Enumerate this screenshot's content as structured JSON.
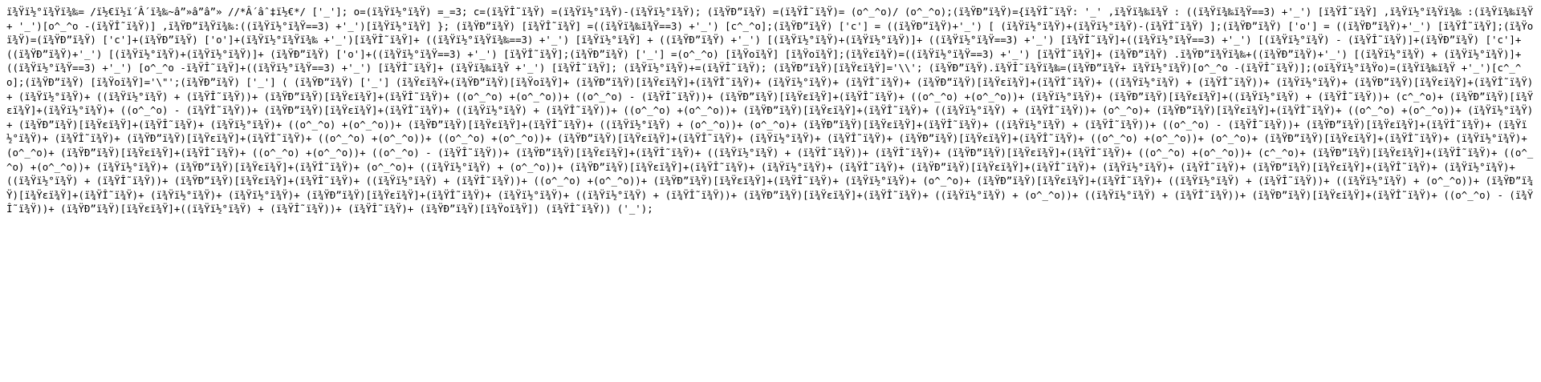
{
  "document": {
    "text_color": "#000000",
    "background_color": "#ffffff",
    "content": "ï¾Ÿï½°ï¾Ÿï¾‰= /ï½€ï½ï´Â´ï¾‰~â”»â”â”» //*Â´âˆ‡ï½€*/ ['_']; o=(ï¾Ÿï½°ï¾Ÿ) =_=3; c=(ï¾ŸÎ˜ï¾Ÿ) =(ï¾Ÿï½°ï¾Ÿ)-(ï¾Ÿï½°ï¾Ÿ); (ï¾ŸÐ”ï¾Ÿ) =(ï¾ŸÎ˜ï¾Ÿ)= (o^_^o)/ (o^_^o);(ï¾ŸÐ”ï¾Ÿ)={ï¾ŸÎ˜ï¾Ÿ: '_' ,ï¾Ÿï¾‰ï¾Ÿ : ((ï¾Ÿï¾‰ï¾Ÿ==3) +'_') [ï¾ŸÎ˜ï¾Ÿ] ,ï¾Ÿï½°ï¾Ÿï¾‰ :(ï¾Ÿï¾‰ï¾Ÿ+ '_')[o^_^o -(ï¾ŸÎ˜ï¾Ÿ)] ,ï¾ŸÐ”ï¾Ÿï¾‰:((ï¾Ÿï½°ï¾Ÿ==3) +'_')[ï¾Ÿï½°ï¾Ÿ] }; (ï¾ŸÐ”ï¾Ÿ) [ï¾ŸÎ˜ï¾Ÿ] =((ï¾Ÿï¾‰ï¾Ÿ==3) +'_') [c^_^o];(ï¾ŸÐ”ï¾Ÿ) ['c'] = ((ï¾ŸÐ”ï¾Ÿ)+'_') [ (ï¾Ÿï½°ï¾Ÿ)+(ï¾Ÿï½°ï¾Ÿ)-(ï¾ŸÎ˜ï¾Ÿ) ];(ï¾ŸÐ”ï¾Ÿ) ['o'] = ((ï¾ŸÐ”ï¾Ÿ)+'_') [ï¾ŸÎ˜ï¾Ÿ];(ï¾Ÿoï¾Ÿ)=(ï¾ŸÐ”ï¾Ÿ) ['c']+(ï¾ŸÐ”ï¾Ÿ) ['o']+(ï¾Ÿï½°ï¾Ÿï¾‰ +'_')[ï¾ŸÎ˜ï¾Ÿ]+ ((ï¾Ÿï½°ï¾Ÿï¾‰==3) +'_') [ï¾Ÿï½°ï¾Ÿ] + ((ï¾ŸÐ”ï¾Ÿ) +'_') [(ï¾Ÿï½°ï¾Ÿ)+(ï¾Ÿï½°ï¾Ÿ)]+ ((ï¾Ÿï½°ï¾Ÿ==3) +'_') [ï¾ŸÎ˜ï¾Ÿ]+((ï¾Ÿï½°ï¾Ÿ==3) +'_') [(ï¾Ÿï½°ï¾Ÿ) - (ï¾ŸÎ˜ï¾Ÿ)]+(ï¾ŸÐ”ï¾Ÿ) ['c']+((ï¾ŸÐ”ï¾Ÿ)+'_') [(ï¾Ÿï½°ï¾Ÿ)+(ï¾Ÿï½°ï¾Ÿ)]+ (ï¾ŸÐ”ï¾Ÿ) ['o']+((ï¾Ÿï½°ï¾Ÿ==3) +'_') [ï¾ŸÎ˜ï¾Ÿ];(ï¾ŸÐ”ï¾Ÿ) ['_'] =(o^_^o) [ï¾Ÿoï¾Ÿ] [ï¾Ÿoï¾Ÿ];(ï¾Ÿεï¾Ÿ)=((ï¾Ÿï½°ï¾Ÿ==3) +'_') [ï¾ŸÎ˜ï¾Ÿ]+ (ï¾ŸÐ”ï¾Ÿ) .ï¾ŸÐ”ï¾Ÿï¾‰+((ï¾ŸÐ”ï¾Ÿ)+'_') [(ï¾Ÿï½°ï¾Ÿ) + (ï¾Ÿï½°ï¾Ÿ)]+((ï¾Ÿï½°ï¾Ÿ==3) +'_') [o^_^o -ï¾ŸÎ˜ï¾Ÿ]+((ï¾Ÿï½°ï¾Ÿ==3) +'_') [ï¾ŸÎ˜ï¾Ÿ]+ (ï¾Ÿï¾‰ï¾Ÿ +'_') [ï¾ŸÎ˜ï¾Ÿ]; (ï¾Ÿï½°ï¾Ÿ)+=(ï¾ŸÎ˜ï¾Ÿ); (ï¾ŸÐ”ï¾Ÿ)[ï¾Ÿεï¾Ÿ]='\\\\'; (ï¾ŸÐ”ï¾Ÿ).ï¾ŸÎ˜ï¾Ÿï¾‰=(ï¾ŸÐ”ï¾Ÿ+ ï¾Ÿï½°ï¾Ÿ)[o^_^o -(ï¾ŸÎ˜ï¾Ÿ)];(oï¾Ÿï½°ï¾Ÿo)=(ï¾Ÿï¾‰ï¾Ÿ +'_')[c^_^o];(ï¾ŸÐ”ï¾Ÿ) [ï¾Ÿoï¾Ÿ]='\\\"';(ï¾ŸÐ”ï¾Ÿ) ['_'] ( (ï¾ŸÐ”ï¾Ÿ) ['_'] (ï¾Ÿεï¾Ÿ+(ï¾ŸÐ”ï¾Ÿ)[ï¾Ÿoï¾Ÿ]+ (ï¾ŸÐ”ï¾Ÿ)[ï¾Ÿεï¾Ÿ]+(ï¾ŸÎ˜ï¾Ÿ)+ (ï¾Ÿï½°ï¾Ÿ)+ (ï¾ŸÎ˜ï¾Ÿ)+ (ï¾ŸÐ”ï¾Ÿ)[ï¾Ÿεï¾Ÿ]+(ï¾ŸÎ˜ï¾Ÿ)+ ((ï¾Ÿï½°ï¾Ÿ) + (ï¾ŸÎ˜ï¾Ÿ))+ (ï¾Ÿï½°ï¾Ÿ)+ (ï¾ŸÐ”ï¾Ÿ)[ï¾Ÿεï¾Ÿ]+(ï¾ŸÎ˜ï¾Ÿ)+ (ï¾Ÿï½°ï¾Ÿ)+ ((ï¾Ÿï½°ï¾Ÿ) + (ï¾ŸÎ˜ï¾Ÿ))+ (ï¾ŸÐ”ï¾Ÿ)[ï¾Ÿεï¾Ÿ]+(ï¾ŸÎ˜ï¾Ÿ)+ ((o^_^o) +(o^_^o))+ ((o^_^o) - (ï¾ŸÎ˜ï¾Ÿ))+ (ï¾ŸÐ”ï¾Ÿ)[ï¾Ÿεï¾Ÿ]+(ï¾ŸÎ˜ï¾Ÿ)+ ((o^_^o) +(o^_^o))+ (ï¾Ÿï½°ï¾Ÿ)+ (ï¾ŸÐ”ï¾Ÿ)[ï¾Ÿεï¾Ÿ]+((ï¾Ÿï½°ï¾Ÿ) + (ï¾ŸÎ˜ï¾Ÿ))+ (c^_^o)+ (ï¾ŸÐ”ï¾Ÿ)[ï¾Ÿεï¾Ÿ]+(ï¾Ÿï½°ï¾Ÿ)+ ((o^_^o) - (ï¾ŸÎ˜ï¾Ÿ))+ (ï¾ŸÐ”ï¾Ÿ)[ï¾Ÿεï¾Ÿ]+(ï¾ŸÎ˜ï¾Ÿ)+ ((ï¾Ÿï½°ï¾Ÿ) + (ï¾ŸÎ˜ï¾Ÿ))+ ((o^_^o) +(o^_^o))+ (ï¾ŸÐ”ï¾Ÿ)[ï¾Ÿεï¾Ÿ]+(ï¾ŸÎ˜ï¾Ÿ)+ ((ï¾Ÿï½°ï¾Ÿ) + (ï¾ŸÎ˜ï¾Ÿ))+ (o^_^o)+ (ï¾ŸÐ”ï¾Ÿ)[ï¾Ÿεï¾Ÿ]+(ï¾ŸÎ˜ï¾Ÿ)+ ((o^_^o) +(o^_^o))+ (ï¾Ÿï½°ï¾Ÿ)+ (ï¾ŸÐ”ï¾Ÿ)[ï¾Ÿεï¾Ÿ]+(ï¾ŸÎ˜ï¾Ÿ)+ (ï¾Ÿï½°ï¾Ÿ)+ ((o^_^o) +(o^_^o))+ (ï¾ŸÐ”ï¾Ÿ)[ï¾Ÿεï¾Ÿ]+(ï¾ŸÎ˜ï¾Ÿ)+ ((ï¾Ÿï½°ï¾Ÿ) + (o^_^o))+ (o^_^o)+ (ï¾ŸÐ”ï¾Ÿ)[ï¾Ÿεï¾Ÿ]+(ï¾ŸÎ˜ï¾Ÿ)+ ((ï¾Ÿï½°ï¾Ÿ) + (ï¾ŸÎ˜ï¾Ÿ))+ ((o^_^o) - (ï¾ŸÎ˜ï¾Ÿ))+ (ï¾ŸÐ”ï¾Ÿ)[ï¾Ÿεï¾Ÿ]+(ï¾ŸÎ˜ï¾Ÿ)+ (ï¾Ÿï½°ï¾Ÿ)+ (ï¾ŸÎ˜ï¾Ÿ)+ (ï¾ŸÐ”ï¾Ÿ)[ï¾Ÿεï¾Ÿ]+(ï¾ŸÎ˜ï¾Ÿ)+ ((o^_^o) +(o^_^o))+ ((o^_^o) +(o^_^o))+ (ï¾ŸÐ”ï¾Ÿ)[ï¾Ÿεï¾Ÿ]+(ï¾ŸÎ˜ï¾Ÿ)+ (ï¾Ÿï½°ï¾Ÿ)+ (ï¾ŸÎ˜ï¾Ÿ)+ (ï¾ŸÐ”ï¾Ÿ)[ï¾Ÿεï¾Ÿ]+(ï¾ŸÎ˜ï¾Ÿ)+ ((o^_^o) +(o^_^o))+ (o^_^o)+ (ï¾ŸÐ”ï¾Ÿ)[ï¾Ÿεï¾Ÿ]+(ï¾ŸÎ˜ï¾Ÿ)+ (ï¾Ÿï½°ï¾Ÿ)+ (o^_^o)+ (ï¾ŸÐ”ï¾Ÿ)[ï¾Ÿεï¾Ÿ]+(ï¾ŸÎ˜ï¾Ÿ)+ ((o^_^o) +(o^_^o))+ ((o^_^o) - (ï¾ŸÎ˜ï¾Ÿ))+ (ï¾ŸÐ”ï¾Ÿ)[ï¾Ÿεï¾Ÿ]+(ï¾ŸÎ˜ï¾Ÿ)+ ((ï¾Ÿï½°ï¾Ÿ) + (ï¾ŸÎ˜ï¾Ÿ))+ (ï¾ŸÎ˜ï¾Ÿ)+ (ï¾ŸÐ”ï¾Ÿ)[ï¾Ÿεï¾Ÿ]+(ï¾ŸÎ˜ï¾Ÿ)+ ((o^_^o) +(o^_^o))+ (c^_^o)+ (ï¾ŸÐ”ï¾Ÿ)[ï¾Ÿεï¾Ÿ]+(ï¾ŸÎ˜ï¾Ÿ)+ ((o^_^o) +(o^_^o))+ (ï¾Ÿï½°ï¾Ÿ)+ (ï¾ŸÐ”ï¾Ÿ)[ï¾Ÿεï¾Ÿ]+(ï¾ŸÎ˜ï¾Ÿ)+ (o^_^o)+ ((ï¾Ÿï½°ï¾Ÿ) + (o^_^o))+ (ï¾ŸÐ”ï¾Ÿ)[ï¾Ÿεï¾Ÿ]+(ï¾ŸÎ˜ï¾Ÿ)+ (ï¾Ÿï½°ï¾Ÿ)+ (ï¾ŸÎ˜ï¾Ÿ)+ (ï¾ŸÐ”ï¾Ÿ)[ï¾Ÿεï¾Ÿ]+(ï¾ŸÎ˜ï¾Ÿ)+ (ï¾Ÿï½°ï¾Ÿ)+ (ï¾ŸÎ˜ï¾Ÿ)+ (ï¾ŸÐ”ï¾Ÿ)[ï¾Ÿεï¾Ÿ]+(ï¾ŸÎ˜ï¾Ÿ)+ (ï¾Ÿï½°ï¾Ÿ)+ ((ï¾Ÿï½°ï¾Ÿ) + (ï¾ŸÎ˜ï¾Ÿ))+ (ï¾ŸÐ”ï¾Ÿ)[ï¾Ÿεï¾Ÿ]+(ï¾ŸÎ˜ï¾Ÿ)+ ((ï¾Ÿï½°ï¾Ÿ) + (ï¾ŸÎ˜ï¾Ÿ))+ ((o^_^o) +(o^_^o))+ (ï¾ŸÐ”ï¾Ÿ)[ï¾Ÿεï¾Ÿ]+(ï¾ŸÎ˜ï¾Ÿ)+ (ï¾Ÿï½°ï¾Ÿ)+ (o^_^o)+ (ï¾ŸÐ”ï¾Ÿ)[ï¾Ÿεï¾Ÿ]+(ï¾ŸÎ˜ï¾Ÿ)+ ((ï¾Ÿï½°ï¾Ÿ) + (ï¾ŸÎ˜ï¾Ÿ))+ ((ï¾Ÿï½°ï¾Ÿ) + (o^_^o))+ (ï¾ŸÐ”ï¾Ÿ)[ï¾Ÿεï¾Ÿ]+(ï¾ŸÎ˜ï¾Ÿ)+ (ï¾Ÿï½°ï¾Ÿ)+ (ï¾Ÿï½°ï¾Ÿ)+ (ï¾ŸÐ”ï¾Ÿ)[ï¾Ÿεï¾Ÿ]+(ï¾ŸÎ˜ï¾Ÿ)+ (ï¾Ÿï½°ï¾Ÿ)+ ((ï¾Ÿï½°ï¾Ÿ) + (ï¾ŸÎ˜ï¾Ÿ))+ (ï¾ŸÐ”ï¾Ÿ)[ï¾Ÿεï¾Ÿ]+(ï¾ŸÎ˜ï¾Ÿ)+ ((ï¾Ÿï½°ï¾Ÿ) + (o^_^o))+ ((ï¾Ÿï½°ï¾Ÿ) + (ï¾ŸÎ˜ï¾Ÿ))+ (ï¾ŸÐ”ï¾Ÿ)[ï¾Ÿεï¾Ÿ]+(ï¾ŸÎ˜ï¾Ÿ)+ ((o^_^o) - (ï¾ŸÎ˜ï¾Ÿ))+ (ï¾ŸÐ”ï¾Ÿ)[ï¾Ÿεï¾Ÿ]+((ï¾Ÿï½°ï¾Ÿ) + (ï¾ŸÎ˜ï¾Ÿ))+ (ï¾ŸÎ˜ï¾Ÿ)+ (ï¾ŸÐ”ï¾Ÿ)[ï¾Ÿoï¾Ÿ]) (ï¾ŸÎ˜ï¾Ÿ)) ('_');"
  }
}
